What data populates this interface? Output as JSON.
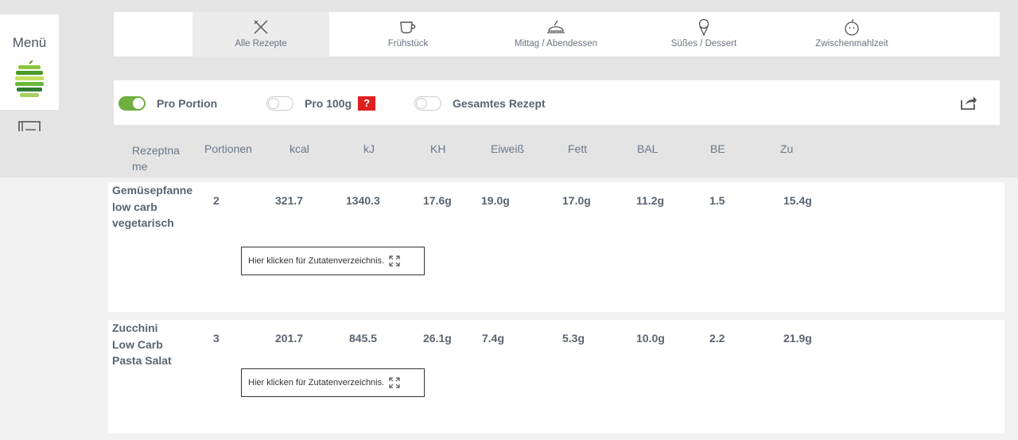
{
  "sidebar": {
    "menu_label": "Menü",
    "logo_icon": "apple-logo",
    "book_icon": "book-icon",
    "user_icon": "user-icon"
  },
  "categories": [
    {
      "label": "Alle Rezepte",
      "icon": "cutlery-icon",
      "active": true
    },
    {
      "label": "Frühstück",
      "icon": "coffee-cup-icon",
      "active": false
    },
    {
      "label": "Mittag / Abendessen",
      "icon": "dinner-plate-icon",
      "active": false
    },
    {
      "label": "Süßes / Dessert",
      "icon": "ice-cream-icon",
      "active": false
    },
    {
      "label": "Zwischenmahlzeit",
      "icon": "apple-icon",
      "active": false
    }
  ],
  "toggles": [
    {
      "label": "Pro Portion",
      "on": true
    },
    {
      "label": "Pro 100g",
      "on": false,
      "help": "?"
    },
    {
      "label": "Gesamtes Rezept",
      "on": false
    }
  ],
  "share_icon": "share-icon",
  "columns": [
    "Rezeptname",
    "Portionen",
    "kcal",
    "kJ",
    "KH",
    "Eiweiß",
    "Fett",
    "BAL",
    "BE",
    "Zu"
  ],
  "rows": [
    {
      "name": "Gemüsepfanne low carb vegetarisch",
      "portionen": "2",
      "kcal": "321.7",
      "kj": "1340.3",
      "kh": "17.6g",
      "eiweiss": "19.0g",
      "fett": "17.0g",
      "bal": "11.2g",
      "be": "1.5",
      "zu": "15.4g",
      "ingredients_button": "Hier klicken für Zutatenverzeichnis."
    },
    {
      "name": "Zucchini Low Carb Pasta Salat",
      "portionen": "3",
      "kcal": "201.7",
      "kj": "845.5",
      "kh": "26.1g",
      "eiweiss": "7.4g",
      "fett": "5.3g",
      "bal": "10.0g",
      "be": "2.2",
      "zu": "21.9g",
      "ingredients_button": "Hier klicken für Zutatenverzeichnis."
    }
  ],
  "colors": {
    "toggle_on": "#6fae3f",
    "help_badge": "#e02020"
  }
}
